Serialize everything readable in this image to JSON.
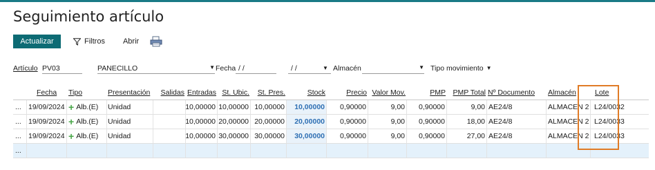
{
  "page": {
    "title": "Seguimiento artículo"
  },
  "toolbar": {
    "refresh_label": "Actualizar",
    "filters_label": "Filtros",
    "open_label": "Abrir"
  },
  "filters": {
    "article_label": "Artículo",
    "article_code": "PV03",
    "article_name": "PANECILLO",
    "date_label": "Fecha",
    "date_from": "/ /",
    "date_to": "/ /",
    "warehouse_label": "Almacén",
    "warehouse_value": "",
    "movement_type_label": "Tipo movimiento"
  },
  "table": {
    "columns": {
      "fecha": "Fecha",
      "tipo": "Tipo",
      "presentacion": "Presentación",
      "salidas": "Salidas",
      "entradas": "Entradas",
      "st_ubic": "St. Ubic.",
      "st_pres": "St. Pres.",
      "stock": "Stock",
      "precio": "Precio",
      "valor_mov": "Valor Mov.",
      "pmp": "PMP",
      "pmp_total": "PMP Total",
      "n_documento": "Nº Documento",
      "almacen": "Almacén",
      "lote": "Lote"
    },
    "rows": [
      {
        "marker": "...",
        "fecha": "19/09/2024",
        "tipo": "Alb.(E)",
        "presentacion": "Unidad",
        "salidas": "",
        "entradas": "10,00000",
        "st_ubic": "10,00000",
        "st_pres": "10,00000",
        "stock": "10,00000",
        "precio": "0,90000",
        "valor_mov": "9,00",
        "pmp": "0,90000",
        "pmp_total": "9,00",
        "n_documento": "AE24/8",
        "almacen": "ALMACEN 2",
        "lote": "L24/0032"
      },
      {
        "marker": "...",
        "fecha": "19/09/2024",
        "tipo": "Alb.(E)",
        "presentacion": "Unidad",
        "salidas": "",
        "entradas": "10,00000",
        "st_ubic": "20,00000",
        "st_pres": "20,00000",
        "stock": "20,00000",
        "precio": "0,90000",
        "valor_mov": "9,00",
        "pmp": "0,90000",
        "pmp_total": "18,00",
        "n_documento": "AE24/8",
        "almacen": "ALMACEN 2",
        "lote": "L24/0033"
      },
      {
        "marker": "...",
        "fecha": "19/09/2024",
        "tipo": "Alb.(E)",
        "presentacion": "Unidad",
        "salidas": "",
        "entradas": "10,00000",
        "st_ubic": "30,00000",
        "st_pres": "30,00000",
        "stock": "30,00000",
        "precio": "0,90000",
        "valor_mov": "9,00",
        "pmp": "0,90000",
        "pmp_total": "27,00",
        "n_documento": "AE24/8",
        "almacen": "ALMACEN 2",
        "lote": "L24/0033"
      }
    ],
    "new_row_marker": "...",
    "row_type_icon": "plus-icon",
    "highlight_color": "#e07b26"
  }
}
